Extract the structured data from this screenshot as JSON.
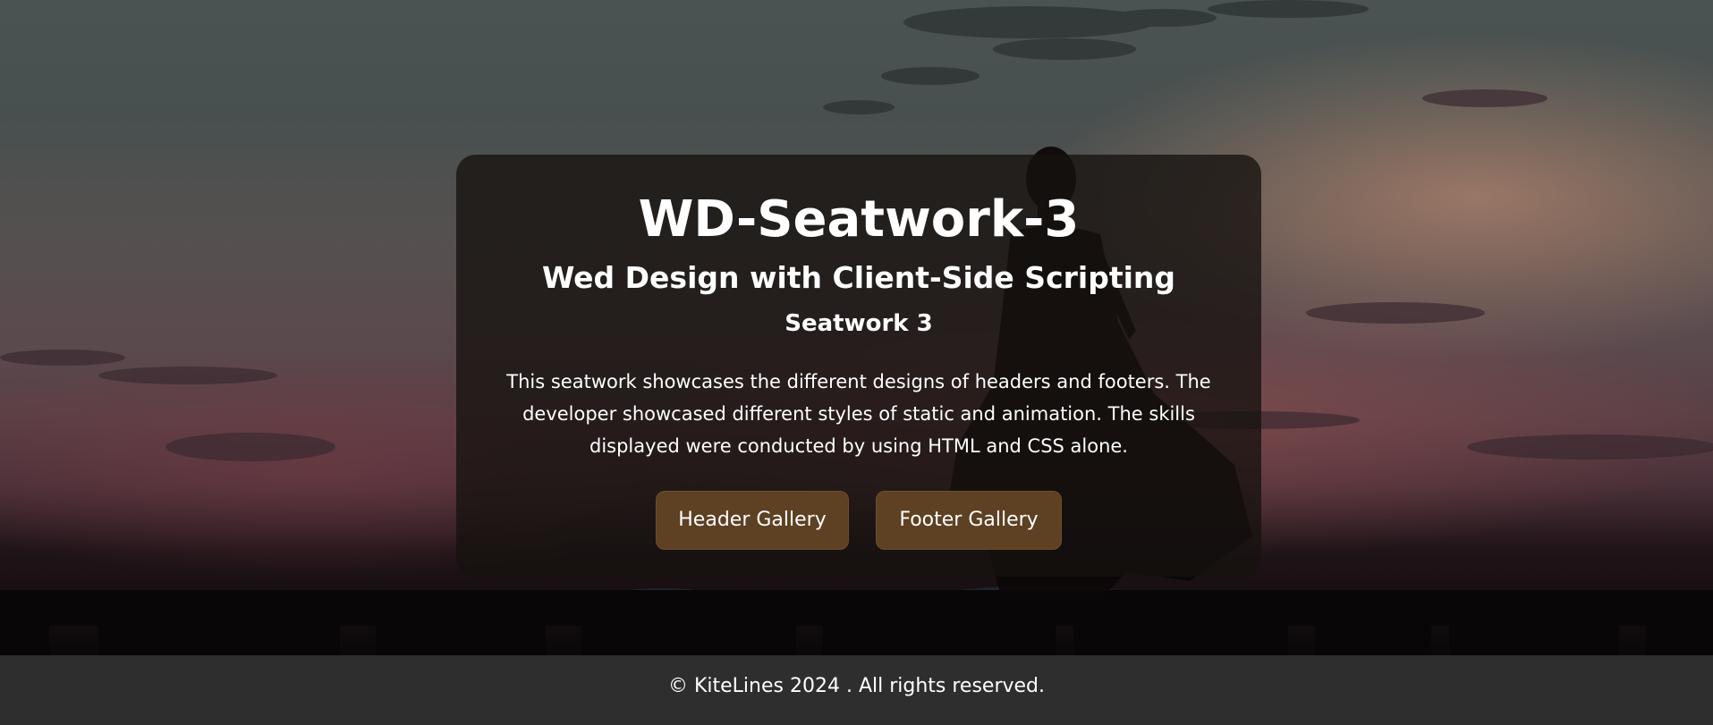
{
  "hero": {
    "background_image": "sunset-pier-silhouette"
  },
  "card": {
    "title": "WD-Seatwork-3",
    "subtitle": "Wed Design with Client-Side Scripting",
    "label": "Seatwork 3",
    "description": "This seatwork showcases the different designs of headers and footers. The developer showcased different styles of static and animation. The skills displayed were conducted by using HTML and CSS alone.",
    "buttons": {
      "header_gallery": "Header Gallery",
      "footer_gallery": "Footer Gallery"
    }
  },
  "footer": {
    "text": "© KiteLines 2024 . All rights reserved."
  },
  "colors": {
    "card_background": "#161210",
    "button_background": "#5e4022",
    "footer_background": "#2e2e2e",
    "text": "#ffffff"
  }
}
